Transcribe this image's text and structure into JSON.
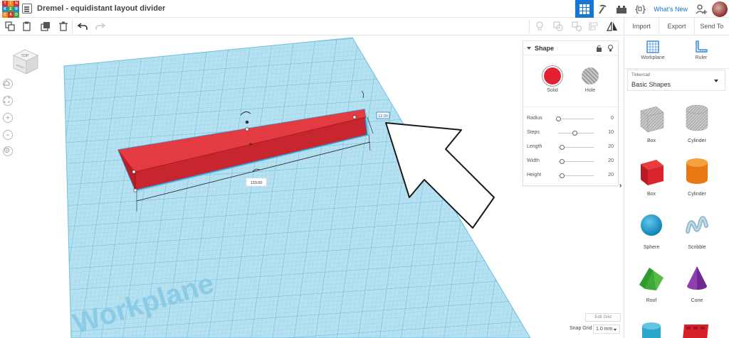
{
  "app": {
    "title": "Dremel - equidistant layout divider",
    "logo_letters": [
      "T",
      "I",
      "N",
      "K",
      "E",
      "R",
      "C",
      "A",
      "D"
    ],
    "whats_new": "What's New"
  },
  "toolbar": {
    "import": "Import",
    "export": "Export",
    "send_to": "Send To"
  },
  "canvas": {
    "workplane_label": "Workplane",
    "dim_length": "133.00",
    "dim_height": "12.00",
    "viewcube_top": "TOP",
    "viewcube_front": "FRONT"
  },
  "shape_panel": {
    "title": "Shape",
    "solid_label": "Solid",
    "hole_label": "Hole",
    "solid_color": "#e3202d",
    "params": [
      {
        "label": "Radius",
        "value": "0",
        "fraction": 0.0
      },
      {
        "label": "Steps",
        "value": "10",
        "fraction": 0.45
      },
      {
        "label": "Length",
        "value": "20",
        "fraction": 0.1
      },
      {
        "label": "Width",
        "value": "20",
        "fraction": 0.1
      },
      {
        "label": "Height",
        "value": "20",
        "fraction": 0.1
      }
    ]
  },
  "library": {
    "workplane": "Workplane",
    "ruler": "Ruler",
    "source": "Tinkercad",
    "category": "Basic Shapes",
    "shapes": [
      "Box",
      "Cylinder",
      "Box",
      "Cylinder",
      "Sphere",
      "Scribble",
      "Roof",
      "Cone"
    ]
  },
  "grid": {
    "edit_grid": "Edit Grid",
    "snap_label": "Snap Grid",
    "snap_value": "1.0 mm"
  },
  "colors": {
    "accent": "#1477d1",
    "workplane": "#a9dcef",
    "box_red": "#e3202d"
  }
}
